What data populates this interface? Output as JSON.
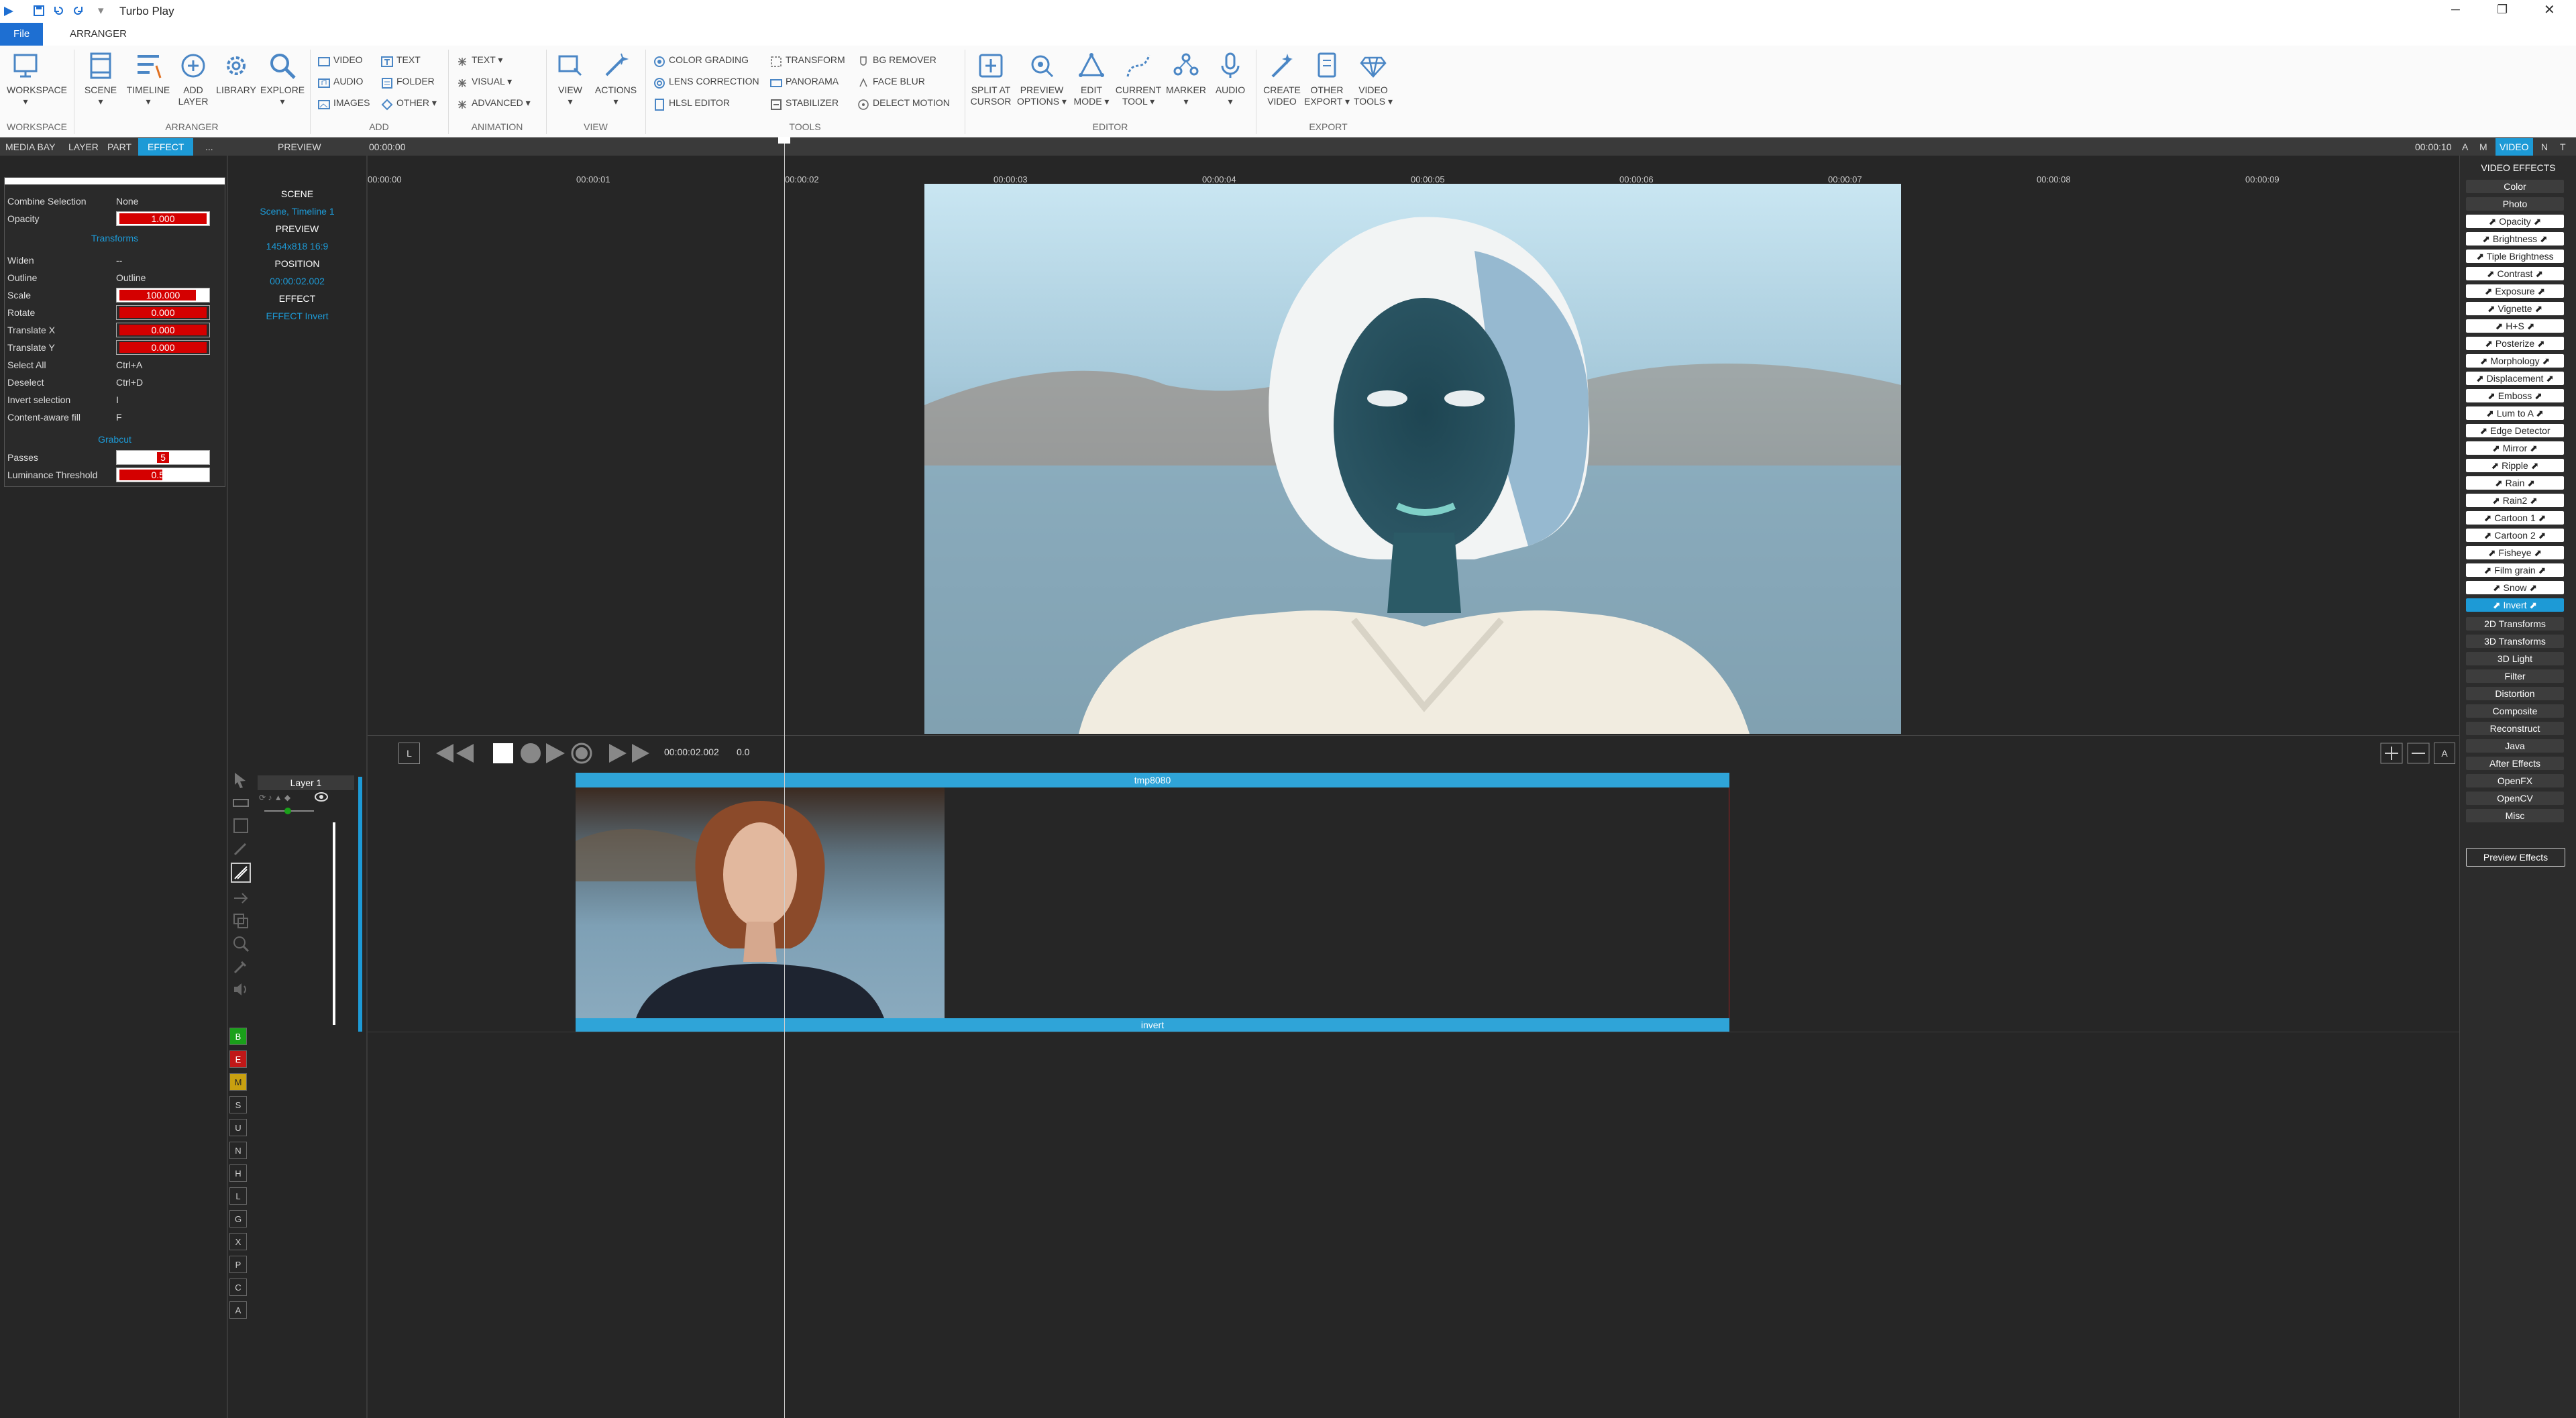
{
  "app": {
    "title": "Turbo Play"
  },
  "menu": {
    "file": "File",
    "arranger": "ARRANGER"
  },
  "ribbon": {
    "workspace": "WORKSPACE",
    "scene": "SCENE",
    "timeline": "TIMELINE",
    "add_layer_1": "ADD",
    "add_layer_2": "LAYER",
    "library": "LIBRARY",
    "explore": "EXPLORE",
    "video": "VIDEO",
    "audio": "AUDIO",
    "images": "IMAGES",
    "text": "TEXT",
    "folder": "FOLDER",
    "other": "OTHER",
    "anim_text": "TEXT",
    "anim_visual": "VISUAL",
    "anim_advanced": "ADVANCED",
    "view": "VIEW",
    "actions": "ACTIONS",
    "color_grading": "COLOR GRADING",
    "lens_correction": "LENS CORRECTION",
    "hlsl_editor": "HLSL EDITOR",
    "transform": "TRANSFORM",
    "panorama": "PANORAMA",
    "stabilizer": "STABILIZER",
    "bg_remover": "BG REMOVER",
    "face_blur": "FACE BLUR",
    "delect_motion": "DELECT MOTION",
    "split_1": "SPLIT AT",
    "split_2": "CURSOR",
    "preview_1": "PREVIEW",
    "preview_2": "OPTIONS",
    "edit_1": "EDIT",
    "edit_2": "MODE",
    "current_1": "CURRENT",
    "current_2": "TOOL",
    "marker": "MARKER",
    "audio_ed": "AUDIO",
    "create_1": "CREATE",
    "create_2": "VIDEO",
    "other_1": "OTHER",
    "other_2": "EXPORT",
    "vtools_1": "VIDEO",
    "vtools_2": "TOOLS",
    "groups": {
      "workspace": "WORKSPACE",
      "arranger": "ARRANGER",
      "add": "ADD",
      "animation": "ANIMATION",
      "view": "VIEW",
      "tools": "TOOLS",
      "editor": "EDITOR",
      "export": "EXPORT"
    }
  },
  "panel_tabs": {
    "media_bay": "MEDIA BAY",
    "layer": "LAYER",
    "part": "PART",
    "effect": "EFFECT",
    "more": "...",
    "preview": "PREVIEW",
    "time": "00:00:00",
    "end_time": "00:00:10",
    "a": "A",
    "m": "M",
    "video": "VIDEO",
    "n": "N",
    "t": "T"
  },
  "props": {
    "combine_selection": "Combine Selection",
    "combine_value": "None",
    "opacity": "Opacity",
    "opacity_value": "1.000",
    "transforms": "Transforms",
    "widen": "Widen",
    "widen_value": "--",
    "outline": "Outline",
    "outline_value": "Outline",
    "scale": "Scale",
    "scale_value": "100.000",
    "rotate": "Rotate",
    "rotate_value": "0.000",
    "translate_x": "Translate X",
    "translate_x_value": "0.000",
    "translate_y": "Translate Y",
    "translate_y_value": "0.000",
    "select_all": "Select All",
    "select_all_key": "Ctrl+A",
    "deselect": "Deselect",
    "deselect_key": "Ctrl+D",
    "invert_selection": "Invert selection",
    "invert_key": "I",
    "content_fill": "Content-aware fill",
    "content_key": "F",
    "grabcut": "Grabcut",
    "passes": "Passes",
    "passes_value": "5",
    "luminance": "Luminance Threshold",
    "luminance_value": "0.500"
  },
  "info": {
    "scene": "SCENE",
    "scene_value": "Scene, Timeline 1",
    "preview": "PREVIEW",
    "preview_value": "1454x818 16:9",
    "position": "POSITION",
    "position_value": "00:00:02.002",
    "effect": "EFFECT",
    "effect_value": "EFFECT Invert"
  },
  "ruler": [
    "00:00:00",
    "00:00:01",
    "00:00:02",
    "00:00:03",
    "00:00:04",
    "00:00:05",
    "00:00:06",
    "00:00:07",
    "00:00:08",
    "00:00:09"
  ],
  "transport": {
    "l": "L",
    "time": "00:00:02.002",
    "speed": "0.0",
    "a": "A"
  },
  "timeline": {
    "layer": "Layer 1",
    "clip_name": "tmp8080",
    "effect_name": "invert"
  },
  "track_buttons": [
    "B",
    "E",
    "M",
    "S",
    "U",
    "N",
    "H",
    "L",
    "G",
    "X",
    "P",
    "C",
    "A"
  ],
  "effects": {
    "title": "VIDEO EFFECTS",
    "top_cats": [
      "Color",
      "Photo"
    ],
    "items": [
      "Opacity",
      "Brightness",
      "Tiple Brightness",
      "Contrast",
      "Exposure",
      "Vignette",
      "H+S",
      "Posterize",
      "Morphology",
      "Displacement",
      "Emboss",
      "Lum to A",
      "Edge Detector",
      "Mirror",
      "Ripple",
      "Rain",
      "Rain2",
      "Cartoon 1",
      "Cartoon 2",
      "Fisheye",
      "Film grain",
      "Snow",
      "Invert"
    ],
    "selected": "Invert",
    "bottom_cats": [
      "2D Transforms",
      "3D Transforms",
      "3D Light",
      "Filter",
      "Distortion",
      "Composite",
      "Reconstruct",
      "Java",
      "After Effects",
      "OpenFX",
      "OpenCV",
      "Misc"
    ],
    "preview_button": "Preview Effects"
  },
  "colors": {
    "accent": "#1d9ad6",
    "red": "#d40000",
    "green": "#1aa01a"
  }
}
